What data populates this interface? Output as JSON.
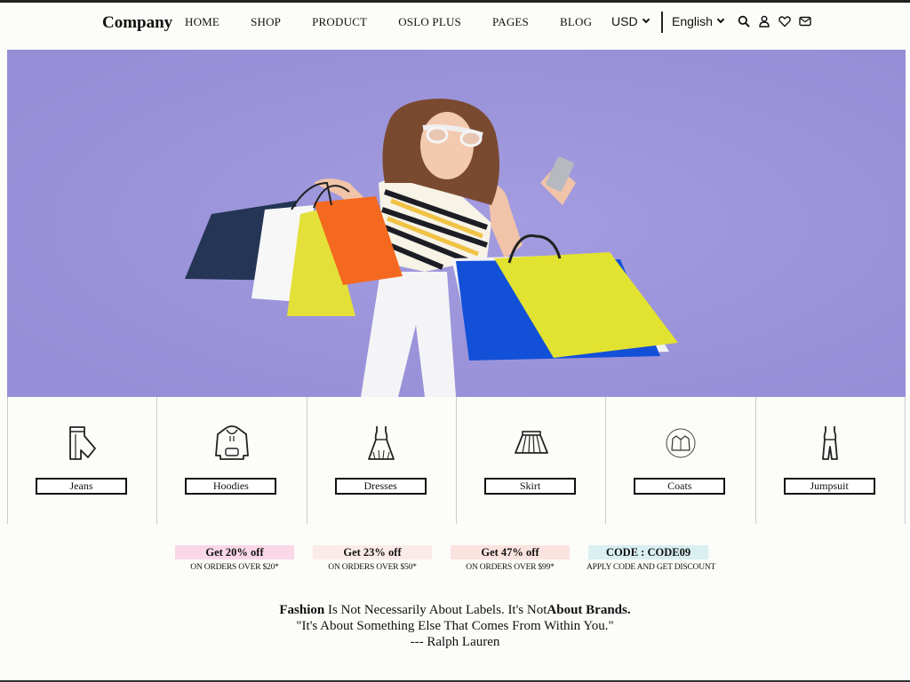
{
  "brand": "Company",
  "nav": [
    "HOME",
    "SHOP",
    "PRODUCT",
    "OSLO PLUS",
    "PAGES",
    "BLOG"
  ],
  "currency": "USD",
  "language": "English",
  "header_icons": [
    "search-icon",
    "user-icon",
    "heart-icon",
    "mail-icon"
  ],
  "hero": {
    "background": "#9b93da"
  },
  "categories": [
    {
      "label": "Jeans",
      "icon": "jeans-icon"
    },
    {
      "label": "Hoodies",
      "icon": "hoodie-icon"
    },
    {
      "label": "Dresses",
      "icon": "dress-icon"
    },
    {
      "label": "Skirt",
      "icon": "skirt-icon"
    },
    {
      "label": "Coats",
      "icon": "coat-icon"
    },
    {
      "label": "Jumpsuit",
      "icon": "jumpsuit-icon"
    }
  ],
  "offers": [
    {
      "title": "Get 20% off",
      "sub": "ON ORDERS OVER $20*",
      "color": "#f9d7e6"
    },
    {
      "title": "Get 23% off",
      "sub": "ON ORDERS OVER $50*",
      "color": "#fbebe8"
    },
    {
      "title": "Get 47% off",
      "sub": "ON ORDERS OVER $99*",
      "color": "#fbe3e0"
    },
    {
      "title": "CODE : CODE09",
      "sub": "APPLY CODE AND GET DISCOUNT",
      "color": "#d9eff1"
    }
  ],
  "quote": {
    "bold1": "Fashion",
    "text1": " Is Not Necessarily About Labels. It's Not",
    "bold2": "About Brands.",
    "line2": "\"It's About Something Else That Comes From Within You.\"",
    "line3": "--- Ralph Lauren"
  }
}
